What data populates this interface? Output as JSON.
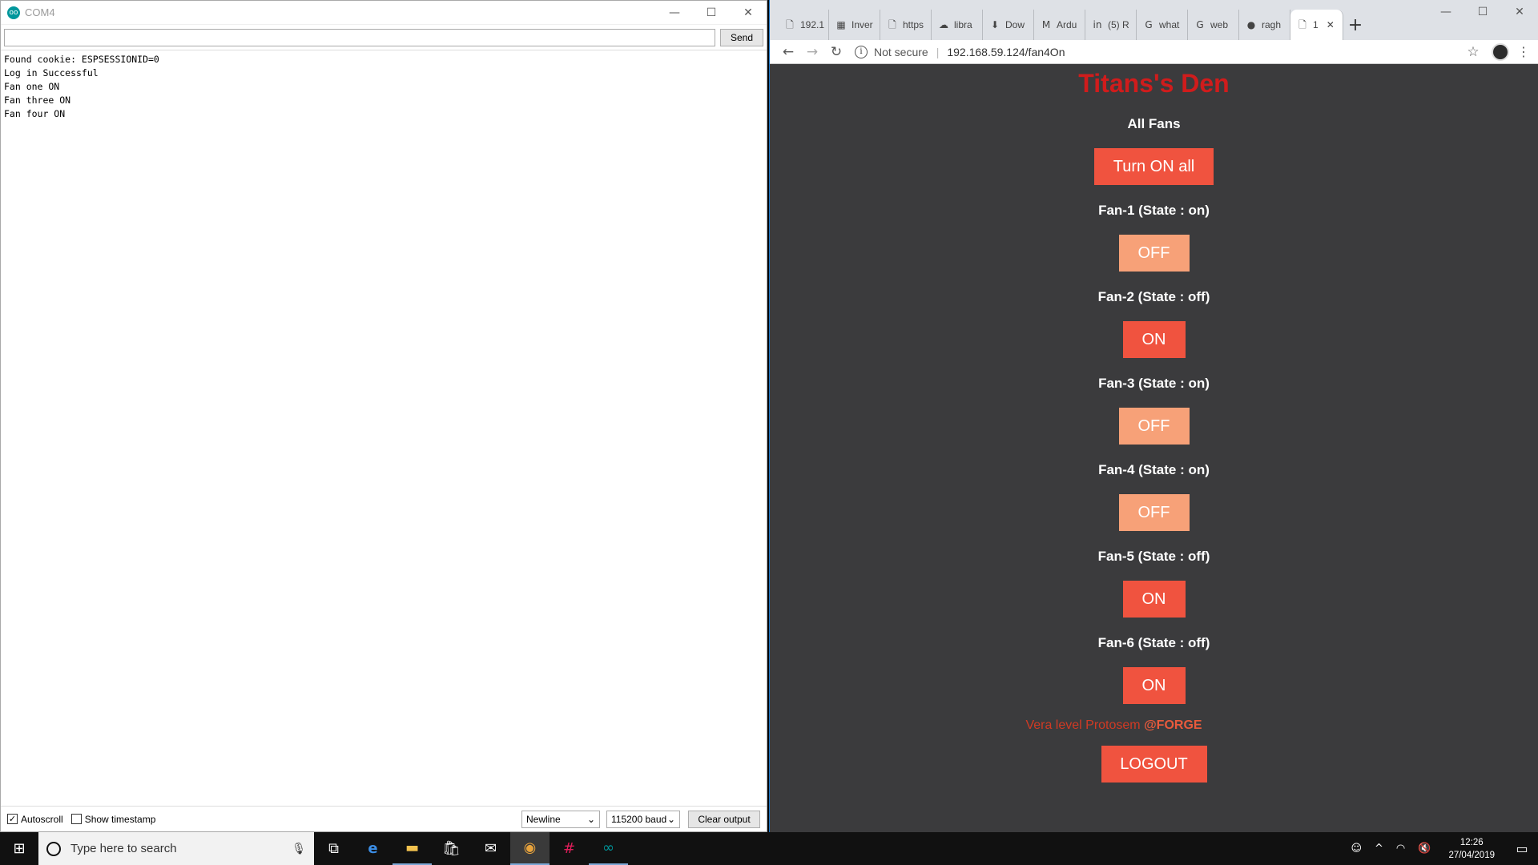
{
  "serial": {
    "title": "COM4",
    "logo": "oo",
    "send_label": "Send",
    "input_value": "",
    "output_lines": [
      "Found cookie: ESPSESSIONID=0",
      "Log in Successful",
      "Fan one ON",
      "Fan three ON",
      "Fan four ON"
    ],
    "autoscroll_label": "Autoscroll",
    "timestamp_label": "Show timestamp",
    "line_ending": "Newline",
    "baud": "115200 baud",
    "clear_label": "Clear output"
  },
  "browser": {
    "tabs": [
      {
        "icon": "document-icon",
        "glyph": "🗋",
        "label": "192.1"
      },
      {
        "icon": "sheets-icon",
        "glyph": "▦",
        "label": "Inver"
      },
      {
        "icon": "document-icon",
        "glyph": "🗋",
        "label": "https"
      },
      {
        "icon": "onedrive-icon",
        "glyph": "☁",
        "label": "libra"
      },
      {
        "icon": "download-icon",
        "glyph": "⬇",
        "label": "Dow"
      },
      {
        "icon": "gmail-icon",
        "glyph": "M",
        "label": "Ardu"
      },
      {
        "icon": "linkedin-icon",
        "glyph": "in",
        "label": "(5) R"
      },
      {
        "icon": "google-icon",
        "glyph": "G",
        "label": "what"
      },
      {
        "icon": "google-icon",
        "glyph": "G",
        "label": "web"
      },
      {
        "icon": "github-icon",
        "glyph": "●",
        "label": "ragh"
      },
      {
        "icon": "document-icon",
        "glyph": "🗋",
        "label": "1"
      }
    ],
    "not_secure": "Not secure",
    "url": "192.168.59.124/fan4On"
  },
  "page": {
    "title": "Titans's Den",
    "all_fans_label": "All Fans",
    "turn_on_all": "Turn ON all",
    "fans": [
      {
        "label": "Fan-1 (State : on)",
        "button": "OFF",
        "state": "on"
      },
      {
        "label": "Fan-2 (State : off)",
        "button": "ON",
        "state": "off"
      },
      {
        "label": "Fan-3 (State : on)",
        "button": "OFF",
        "state": "on"
      },
      {
        "label": "Fan-4 (State : on)",
        "button": "OFF",
        "state": "on"
      },
      {
        "label": "Fan-5 (State : off)",
        "button": "ON",
        "state": "off"
      },
      {
        "label": "Fan-6 (State : off)",
        "button": "ON",
        "state": "off"
      }
    ],
    "credit_text": "Vera level Protosem ",
    "credit_brand": "@FORGE",
    "logout": "LOGOUT"
  },
  "taskbar": {
    "search_placeholder": "Type here to search",
    "time": "12:26",
    "date": "27/04/2019"
  },
  "colors": {
    "accent_red": "#d01c1c",
    "button_on": "#f0533f",
    "button_off": "#f7a178",
    "page_bg": "#3b3b3d"
  }
}
